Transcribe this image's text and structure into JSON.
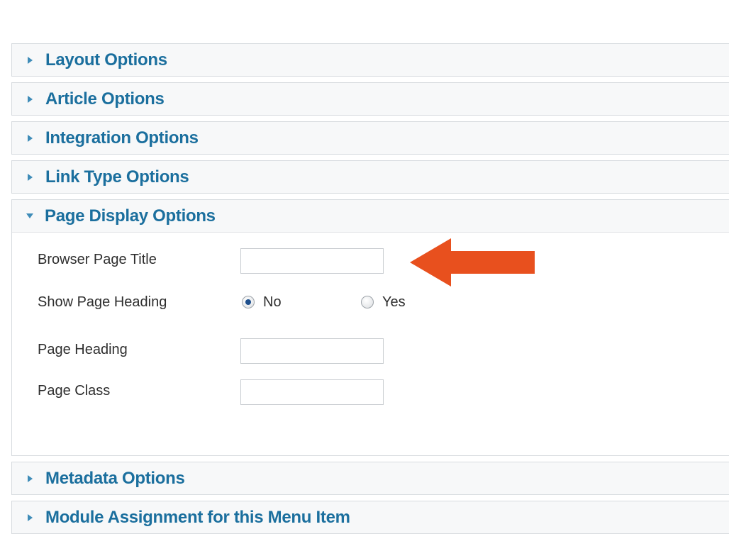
{
  "accordion": {
    "panels": [
      {
        "label": "Layout Options",
        "state": "collapsed"
      },
      {
        "label": "Article Options",
        "state": "collapsed"
      },
      {
        "label": "Integration Options",
        "state": "collapsed"
      },
      {
        "label": "Link Type Options",
        "state": "collapsed"
      },
      {
        "label": "Page Display Options",
        "state": "expanded"
      },
      {
        "label": "Metadata Options",
        "state": "collapsed"
      },
      {
        "label": "Module Assignment for this Menu Item",
        "state": "collapsed"
      }
    ]
  },
  "page_display": {
    "browser_page_title": {
      "label": "Browser Page Title",
      "value": ""
    },
    "show_page_heading": {
      "label": "Show Page Heading",
      "options": [
        "No",
        "Yes"
      ],
      "selected": "No"
    },
    "page_heading": {
      "label": "Page Heading",
      "value": ""
    },
    "page_class": {
      "label": "Page Class",
      "value": ""
    }
  },
  "annotation": {
    "arrow_color": "#e8501e",
    "icon": "arrow-left-icon"
  },
  "colors": {
    "panel_title": "#1b6f9e",
    "panel_arrow": "#3f8cb8",
    "panel_bg": "#f7f8f9",
    "border": "#d7dbdf"
  }
}
